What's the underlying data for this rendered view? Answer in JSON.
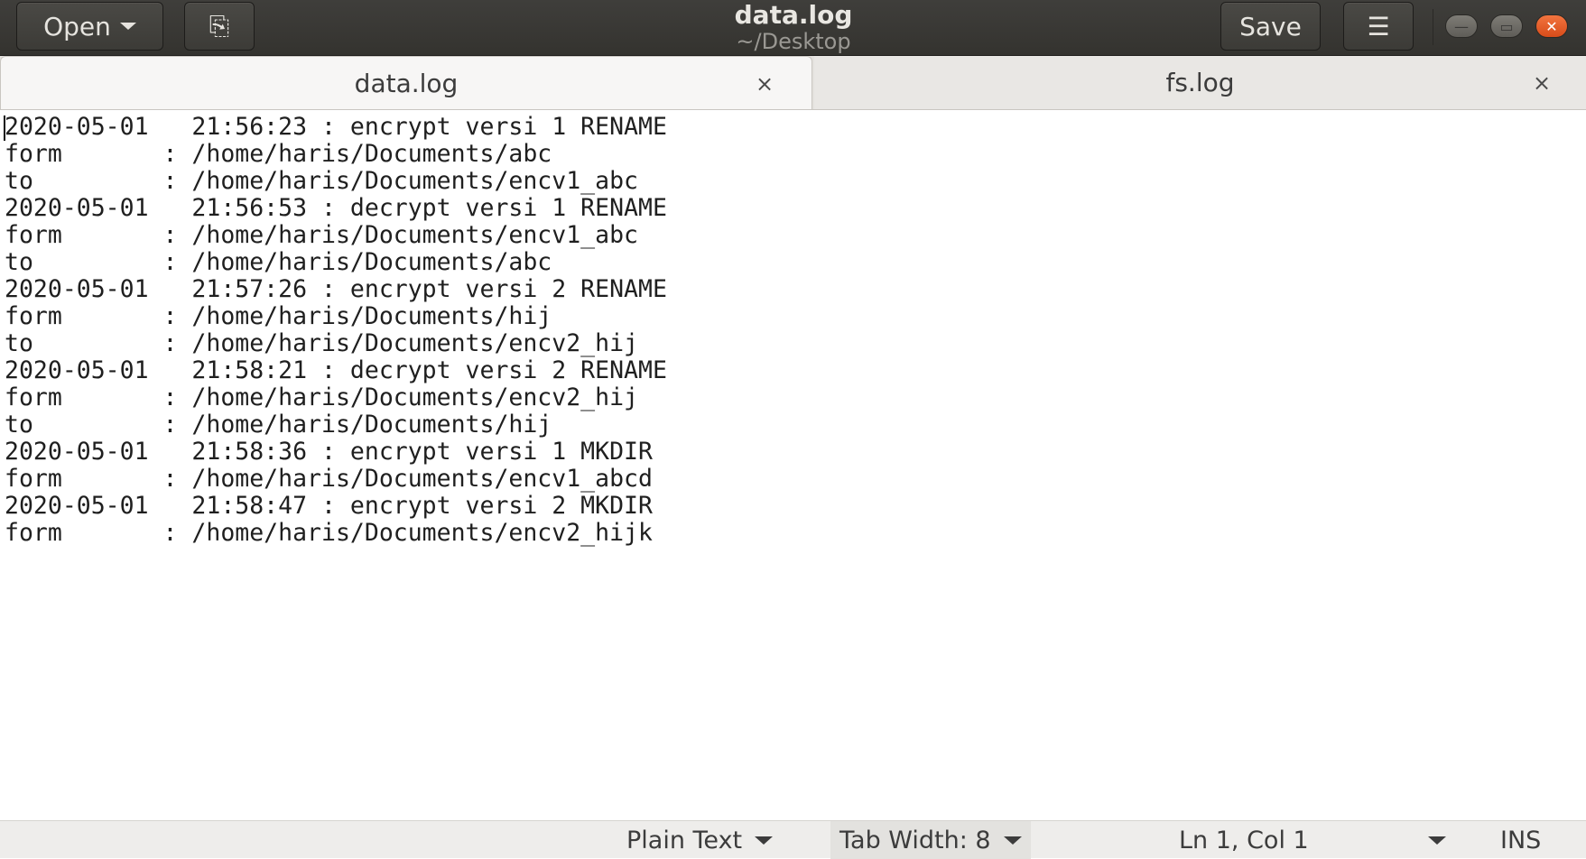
{
  "header": {
    "open_label": "Open",
    "title": "data.log",
    "subtitle": "~/Desktop",
    "save_label": "Save",
    "menu_icon": "☰",
    "newdoc_icon": "⎘",
    "close_icon": "✕"
  },
  "tabs": [
    {
      "label": "data.log",
      "close": "×",
      "active": true
    },
    {
      "label": "fs.log",
      "close": "×",
      "active": false
    }
  ],
  "editor": {
    "content": "2020-05-01   21:56:23 : encrypt versi 1 RENAME\nform       : /home/haris/Documents/abc\nto         : /home/haris/Documents/encv1_abc\n2020-05-01   21:56:53 : decrypt versi 1 RENAME\nform       : /home/haris/Documents/encv1_abc\nto         : /home/haris/Documents/abc\n2020-05-01   21:57:26 : encrypt versi 2 RENAME\nform       : /home/haris/Documents/hij\nto         : /home/haris/Documents/encv2_hij\n2020-05-01   21:58:21 : decrypt versi 2 RENAME\nform       : /home/haris/Documents/encv2_hij\nto         : /home/haris/Documents/hij\n2020-05-01   21:58:36 : encrypt versi 1 MKDIR\nform       : /home/haris/Documents/encv1_abcd\n2020-05-01   21:58:47 : encrypt versi 2 MKDIR\nform       : /home/haris/Documents/encv2_hijk"
  },
  "statusbar": {
    "language": "Plain Text",
    "tab_width": "Tab Width: 8",
    "position": "Ln 1, Col 1",
    "mode": "INS"
  }
}
